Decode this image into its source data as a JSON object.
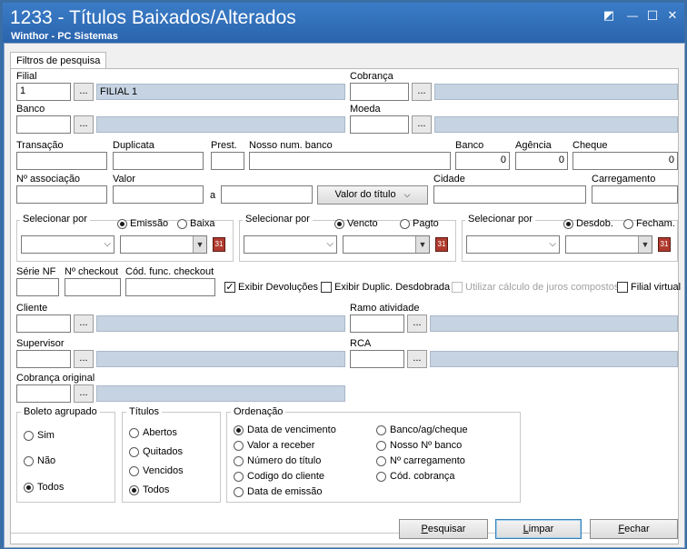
{
  "window": {
    "title": "1233 - Títulos Baixados/Alterados",
    "subtitle": "Winthor - PC Sistemas",
    "controls": {
      "restore": "◩",
      "minimize": "—",
      "maximize": "☐",
      "close": "✕"
    }
  },
  "tab": {
    "label": "Filtros de pesquisa"
  },
  "dots_label": "...",
  "fields": {
    "filial": {
      "label": "Filial",
      "code": "1",
      "desc": "FILIAL 1"
    },
    "cobranca": {
      "label": "Cobrança",
      "code": "",
      "desc": ""
    },
    "banco": {
      "label": "Banco",
      "code": "",
      "desc": ""
    },
    "moeda": {
      "label": "Moeda",
      "code": "",
      "desc": ""
    },
    "transacao": {
      "label": "Transação",
      "value": ""
    },
    "duplicata": {
      "label": "Duplicata",
      "value": ""
    },
    "prest": {
      "label": "Prest.",
      "value": ""
    },
    "nosso_num": {
      "label": "Nosso num. banco",
      "value": ""
    },
    "banco_num": {
      "label": "Banco",
      "value": "0"
    },
    "agencia": {
      "label": "Agência",
      "value": "0"
    },
    "cheque": {
      "label": "Cheque",
      "value": "0"
    },
    "num_associacao": {
      "label": "Nº associação",
      "value": ""
    },
    "valor": {
      "label": "Valor",
      "from": "",
      "sep": "a",
      "to": ""
    },
    "valor_combo": {
      "value": "Valor do título"
    },
    "cidade": {
      "label": "Cidade",
      "value": ""
    },
    "carregamento": {
      "label": "Carregamento",
      "value": ""
    },
    "serie_nf": {
      "label": "Série NF",
      "value": ""
    },
    "num_checkout": {
      "label": "Nº checkout",
      "value": ""
    },
    "cod_func_checkout": {
      "label": "Cód. func. checkout",
      "value": ""
    },
    "cliente": {
      "label": "Cliente",
      "code": "",
      "desc": ""
    },
    "ramo": {
      "label": "Ramo atividade",
      "code": "",
      "desc": ""
    },
    "supervisor": {
      "label": "Supervisor",
      "code": "",
      "desc": ""
    },
    "rca": {
      "label": "RCA",
      "code": "",
      "desc": ""
    },
    "cobranca_original": {
      "label": "Cobrança original",
      "code": "",
      "desc": ""
    }
  },
  "date_groups": [
    {
      "title": "Selecionar por",
      "opt1": "Emissão",
      "opt2": "Baixa",
      "selected": 1
    },
    {
      "title": "Selecionar por",
      "opt1": "Vencto",
      "opt2": "Pagto",
      "selected": 1
    },
    {
      "title": "Selecionar por",
      "opt1": "Desdob.",
      "opt2": "Fecham.",
      "selected": 1
    }
  ],
  "checkboxes": {
    "exibir_devolucoes": {
      "label": "Exibir Devoluções",
      "checked": true
    },
    "exibir_duplic": {
      "label": "Exibir Duplic. Desdobrada",
      "checked": false
    },
    "juros": {
      "label": "Utilizar cálculo de juros compostos",
      "checked": false,
      "disabled": true
    },
    "filial_virtual": {
      "label": "Filial virtual",
      "checked": false
    }
  },
  "boleto": {
    "title": "Boleto agrupado",
    "options": [
      "Sim",
      "Não",
      "Todos"
    ],
    "selected": 2
  },
  "titulos": {
    "title": "Títulos",
    "options": [
      "Abertos",
      "Quitados",
      "Vencidos",
      "Todos"
    ],
    "selected": 3
  },
  "ordenacao": {
    "title": "Ordenação",
    "col1": [
      "Data de vencimento",
      "Valor a receber",
      "Número do título",
      "Codigo do cliente",
      "Data de emissão"
    ],
    "col2": [
      "Banco/ag/cheque",
      "Nosso Nº banco",
      "Nº carregamento",
      "Cód. cobrança"
    ],
    "selected": "Data de vencimento"
  },
  "buttons": {
    "pesquisar": {
      "first": "P",
      "rest": "esquisar"
    },
    "limpar": {
      "first": "L",
      "rest": "impar"
    },
    "fechar": {
      "first": "F",
      "rest": "echar"
    }
  }
}
